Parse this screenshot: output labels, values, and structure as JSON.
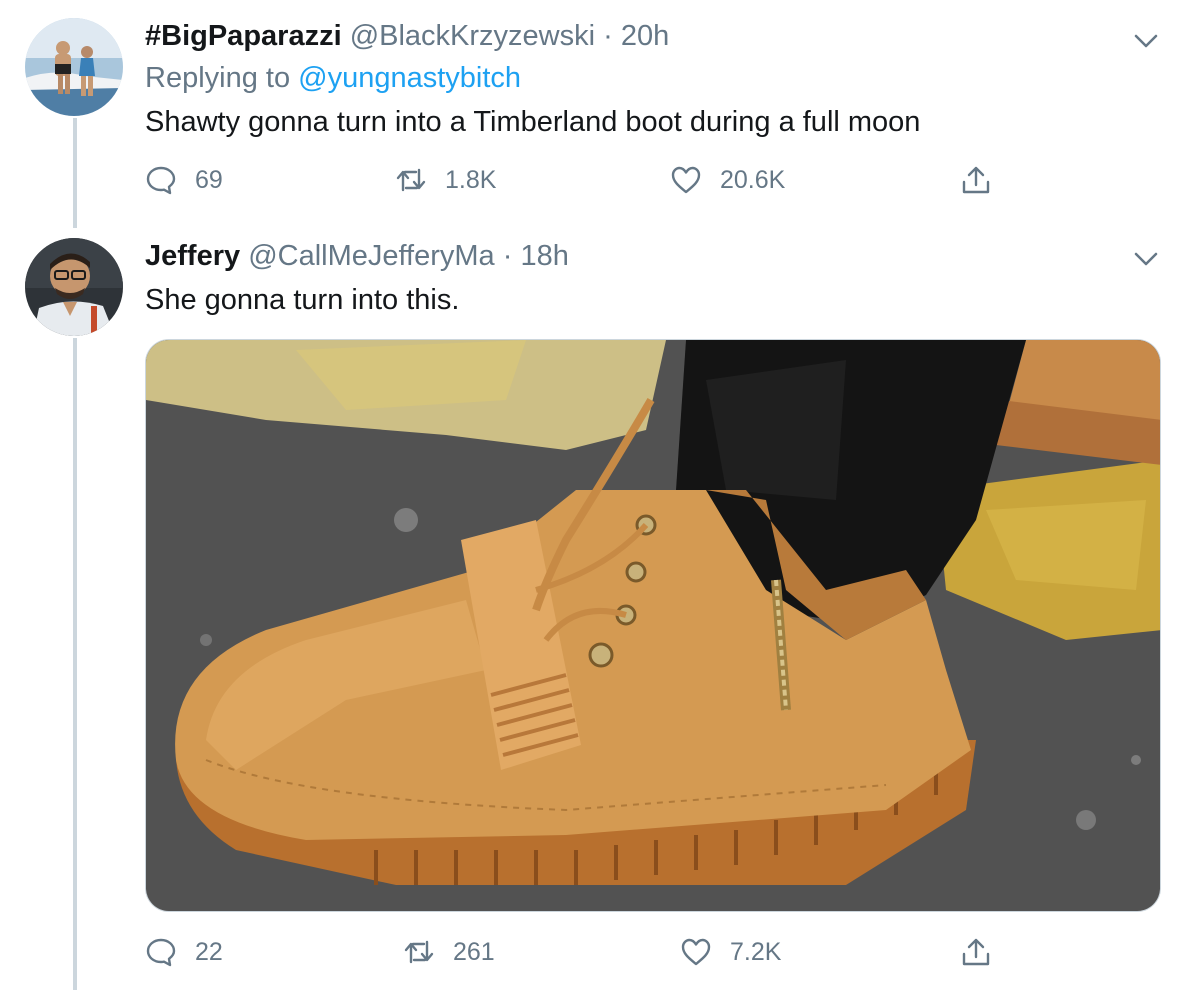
{
  "tweets": [
    {
      "display_name": "#BigPaparazzi",
      "handle": "@BlackKrzyzewski",
      "separator": "·",
      "time": "20h",
      "replying_prefix": "Replying to",
      "replying_to": "@yungnastybitch",
      "text": "Shawty gonna turn into a Timberland boot during a full moon",
      "replies": "69",
      "retweets": "1.8K",
      "likes": "20.6K"
    },
    {
      "display_name": "Jeffery",
      "handle": "@CallMeJefferyMa",
      "separator": "·",
      "time": "18h",
      "text": "She gonna turn into this.",
      "replies": "22",
      "retweets": "261",
      "likes": "7.2K"
    }
  ],
  "icons": {
    "reply": "reply-icon",
    "retweet": "retweet-icon",
    "like": "heart-icon",
    "share": "share-icon",
    "menu": "chevron-down-icon"
  },
  "colors": {
    "link": "#1da1f2",
    "muted": "#657786",
    "thread_line": "#ccd6dd"
  }
}
